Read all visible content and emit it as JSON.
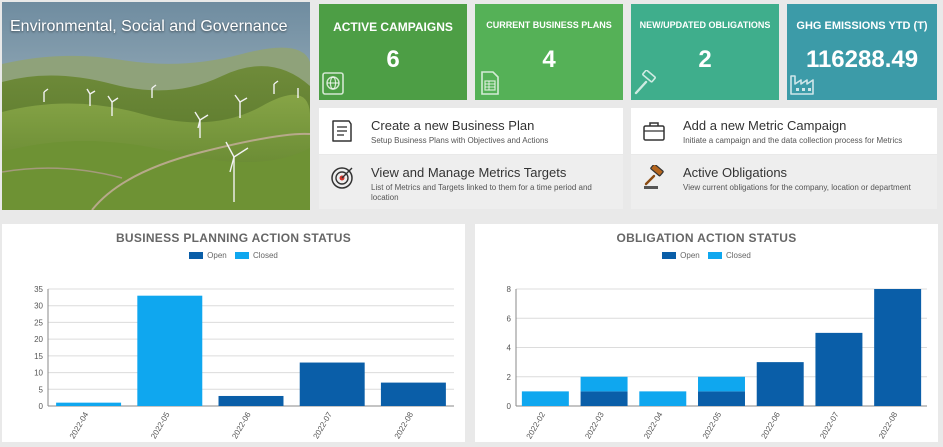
{
  "hero": {
    "title": "Environmental, Social and Governance"
  },
  "kpis": [
    {
      "title": "ACTIVE CAMPAIGNS",
      "value": "6",
      "color": "#4d9e45",
      "icon": "globe-icon"
    },
    {
      "title": "CURRENT BUSINESS PLANS",
      "value": "4",
      "color": "#55b157",
      "icon": "spreadsheet-icon"
    },
    {
      "title": "NEW/UPDATED OBLIGATIONS",
      "value": "2",
      "color": "#3fae8c",
      "icon": "gavel-icon"
    },
    {
      "title": "GHG EMISSIONS YTD (T)",
      "value": "116288.49",
      "color": "#3c9ba8",
      "icon": "factory-icon"
    }
  ],
  "actions": [
    {
      "title": "Create a new Business Plan",
      "description": "Setup Business Plans with Objectives and Actions",
      "icon": "document-icon"
    },
    {
      "title": "Add a new Metric Campaign",
      "description": "Initiate a campaign and the data collection process for Metrics",
      "icon": "briefcase-icon"
    },
    {
      "title": "View and Manage Metrics Targets",
      "description": "List of Metrics and Targets linked to them for a time period and location",
      "icon": "target-icon"
    },
    {
      "title": "Active Obligations",
      "description": "View current obligations for the company, location or department",
      "icon": "gavel-icon"
    }
  ],
  "colors": {
    "open": "#0a5ea8",
    "closed": "#0fa7ef"
  },
  "chart_data": [
    {
      "type": "bar",
      "stacked": true,
      "title": "BUSINESS PLANNING ACTION STATUS",
      "categories": [
        "2022-04",
        "2022-05",
        "2022-06",
        "2022-07",
        "2022-08"
      ],
      "series": [
        {
          "name": "Open",
          "values": [
            0,
            0,
            3,
            13,
            7
          ]
        },
        {
          "name": "Closed",
          "values": [
            1,
            33,
            0,
            0,
            0
          ]
        }
      ],
      "ylim": [
        0,
        35
      ],
      "yticks": [
        0,
        5,
        10,
        15,
        20,
        25,
        30,
        35
      ],
      "grid": true,
      "legend": "top-center"
    },
    {
      "type": "bar",
      "stacked": true,
      "title": "OBLIGATION ACTION STATUS",
      "categories": [
        "2022-02",
        "2022-03",
        "2022-04",
        "2022-05",
        "2022-06",
        "2022-07",
        "2022-08"
      ],
      "series": [
        {
          "name": "Open",
          "values": [
            0,
            1,
            0,
            1,
            3,
            5,
            8
          ]
        },
        {
          "name": "Closed",
          "values": [
            1,
            1,
            1,
            1,
            0,
            0,
            0
          ]
        }
      ],
      "ylim": [
        0,
        8
      ],
      "yticks": [
        0,
        2,
        4,
        6,
        8
      ],
      "grid": true,
      "legend": "top-center"
    }
  ]
}
